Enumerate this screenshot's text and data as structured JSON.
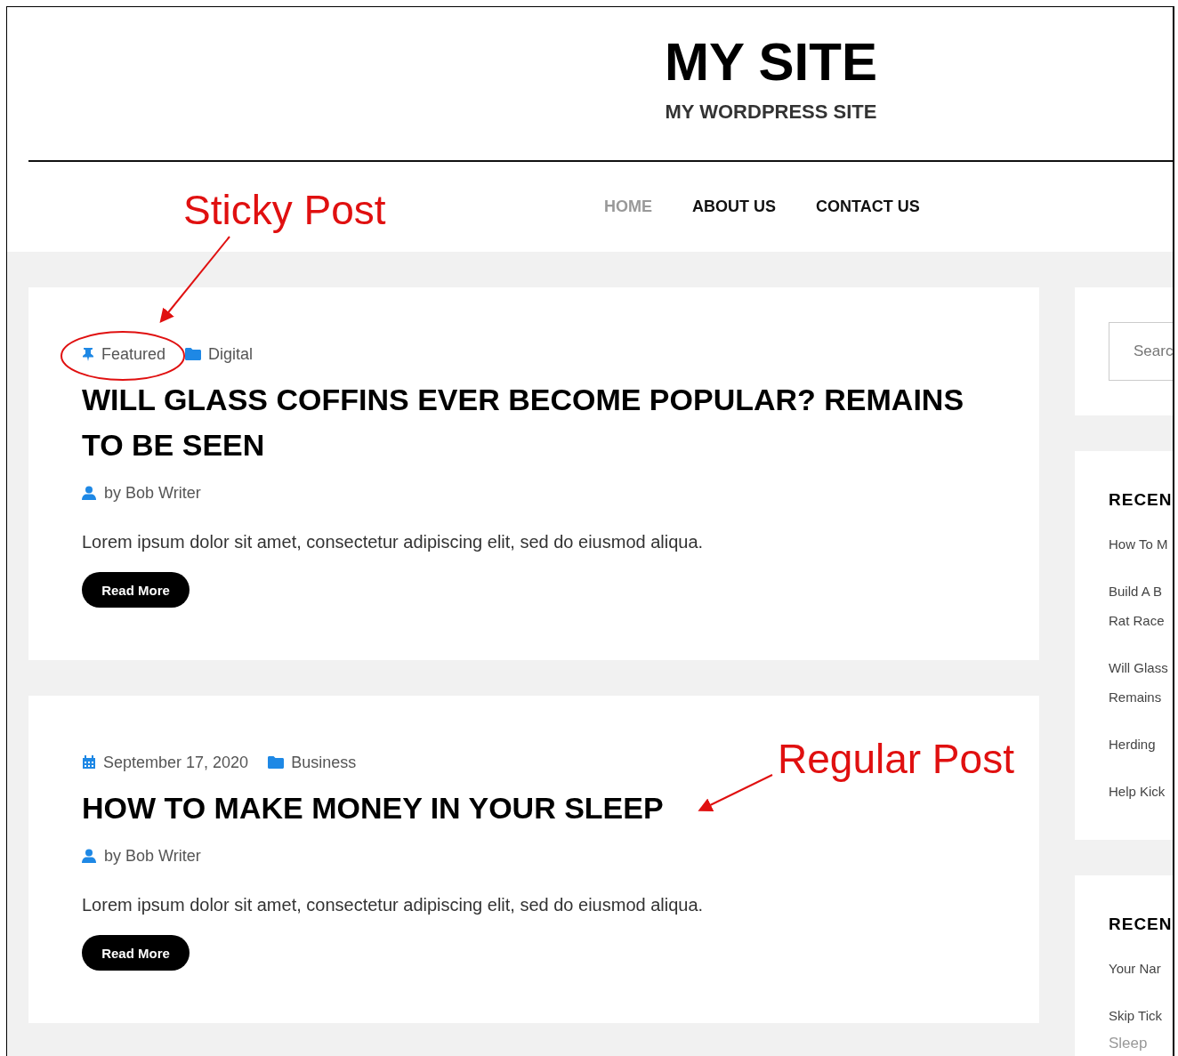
{
  "site": {
    "title": "MY SITE",
    "tagline": "MY WORDPRESS SITE"
  },
  "nav": [
    {
      "label": "HOME",
      "selected": true
    },
    {
      "label": "ABOUT US",
      "selected": false
    },
    {
      "label": "CONTACT US",
      "selected": false
    }
  ],
  "posts": [
    {
      "meta": [
        {
          "kind": "featured",
          "text": "Featured"
        },
        {
          "kind": "category",
          "text": "Digital"
        }
      ],
      "title": "WILL GLASS COFFINS EVER BECOME POPULAR? REMAINS TO BE SEEN",
      "author": "by Bob Writer",
      "excerpt": "Lorem ipsum dolor sit amet, consectetur adipiscing elit, sed do eiusmod aliqua.",
      "button": "Read More"
    },
    {
      "meta": [
        {
          "kind": "date",
          "text": "September 17, 2020"
        },
        {
          "kind": "category",
          "text": "Business"
        }
      ],
      "title": "HOW TO MAKE MONEY IN YOUR SLEEP",
      "author": "by Bob Writer",
      "excerpt": "Lorem ipsum dolor sit amet, consectetur adipiscing elit, sed do eiusmod aliqua.",
      "button": "Read More"
    }
  ],
  "sidebar": {
    "search": {
      "placeholder": "Searc"
    },
    "widgets": [
      {
        "heading": "RECEN",
        "items": [
          {
            "lines": [
              "How To M"
            ]
          },
          {
            "lines": [
              "Build A B",
              "Rat Race"
            ]
          },
          {
            "lines": [
              "Will Glass",
              "Remains"
            ]
          },
          {
            "lines": [
              "Herding"
            ]
          },
          {
            "lines": [
              "Help Kick"
            ]
          }
        ]
      },
      {
        "heading": "RECEN",
        "items": [
          {
            "lines": [
              "Your Nar"
            ]
          },
          {
            "lines": [
              "Skip Tick"
            ],
            "note": "Sleep"
          }
        ]
      }
    ]
  },
  "annotations": [
    {
      "kind": "sticky",
      "label": "Sticky Post"
    },
    {
      "kind": "regular",
      "label": "Regular Post"
    }
  ]
}
